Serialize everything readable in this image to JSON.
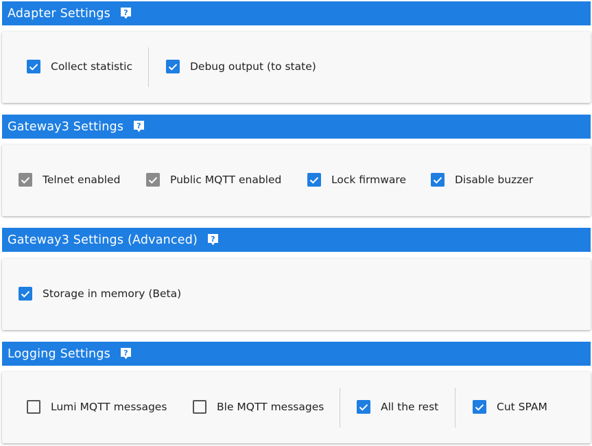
{
  "colors": {
    "accent": "#1e7ee1",
    "disabled_check": "#8b8b8b",
    "card_bg": "#f8f8f8"
  },
  "sections": {
    "adapter": {
      "title": "Adapter Settings",
      "options": [
        {
          "label": "Collect statistic",
          "checked": true,
          "disabled": false
        },
        {
          "label": "Debug output (to state)",
          "checked": true,
          "disabled": false
        }
      ]
    },
    "gateway3": {
      "title": "Gateway3 Settings",
      "options": [
        {
          "label": "Telnet enabled",
          "checked": true,
          "disabled": true
        },
        {
          "label": "Public MQTT enabled",
          "checked": true,
          "disabled": true
        },
        {
          "label": "Lock firmware",
          "checked": true,
          "disabled": false
        },
        {
          "label": "Disable buzzer",
          "checked": true,
          "disabled": false
        }
      ]
    },
    "gateway3_advanced": {
      "title": "Gateway3 Settings (Advanced)",
      "options": [
        {
          "label": "Storage in memory (Beta)",
          "checked": true,
          "disabled": false
        }
      ]
    },
    "logging": {
      "title": "Logging Settings",
      "options": [
        {
          "label": "Lumi MQTT messages",
          "checked": false,
          "disabled": false
        },
        {
          "label": "Ble MQTT messages",
          "checked": false,
          "disabled": false
        },
        {
          "label": "All the rest",
          "checked": true,
          "disabled": false
        },
        {
          "label": "Cut SPAM",
          "checked": true,
          "disabled": false
        }
      ]
    }
  },
  "icons": {
    "help": "help-icon",
    "check": "check-icon"
  }
}
